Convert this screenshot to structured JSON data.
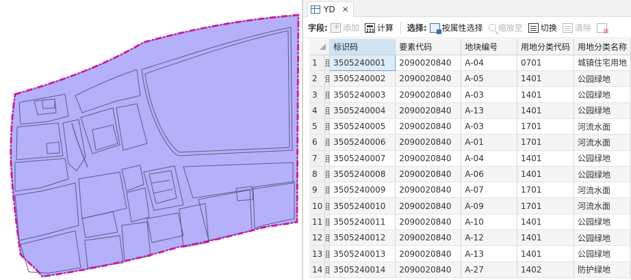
{
  "colors": {
    "parcel_fill": "#b4b0fa",
    "parcel_stroke": "#565e86",
    "boundary": "#d31aa3",
    "selection": "#ddecf8"
  },
  "tab": {
    "icon": "table-icon",
    "title": "YD",
    "close_icon": "close-icon"
  },
  "toolbar": {
    "field_label": "字段:",
    "add_label": "添加",
    "calc_label": "计算",
    "select_label": "选择:",
    "select_by_attr_label": "按属性选择",
    "zoom_label": "缩放至",
    "switch_label": "切换",
    "clear_label": "清除"
  },
  "table": {
    "headers": [
      "标识码",
      "要素代码",
      "地块编号",
      "用地分类代码",
      "用地分类名称"
    ],
    "selected_column": 0,
    "rows": [
      {
        "n": "1",
        "c": [
          "3505240001",
          "2090020840",
          "A-04",
          "0701",
          "城镇住宅用地"
        ]
      },
      {
        "n": "2",
        "c": [
          "3505240002",
          "2090020840",
          "A-05",
          "1401",
          "公园绿地"
        ]
      },
      {
        "n": "3",
        "c": [
          "3505240003",
          "2090020840",
          "A-03",
          "1401",
          "公园绿地"
        ]
      },
      {
        "n": "4",
        "c": [
          "3505240004",
          "2090020840",
          "A-13",
          "1401",
          "公园绿地"
        ]
      },
      {
        "n": "5",
        "c": [
          "3505240005",
          "2090020840",
          "A-03",
          "1701",
          "河流水面"
        ]
      },
      {
        "n": "6",
        "c": [
          "3505240006",
          "2090020840",
          "A-01",
          "1701",
          "河流水面"
        ]
      },
      {
        "n": "7",
        "c": [
          "3505240007",
          "2090020840",
          "A-04",
          "1401",
          "公园绿地"
        ]
      },
      {
        "n": "8",
        "c": [
          "3505240008",
          "2090020840",
          "A-06",
          "1401",
          "公园绿地"
        ]
      },
      {
        "n": "9",
        "c": [
          "3505240009",
          "2090020840",
          "A-07",
          "1701",
          "河流水面"
        ]
      },
      {
        "n": "10",
        "c": [
          "3505240010",
          "2090020840",
          "A-09",
          "1701",
          "河流水面"
        ]
      },
      {
        "n": "11",
        "c": [
          "3505240011",
          "2090020840",
          "A-10",
          "1401",
          "公园绿地"
        ]
      },
      {
        "n": "12",
        "c": [
          "3505240012",
          "2090020840",
          "A-12",
          "1401",
          "公园绿地"
        ]
      },
      {
        "n": "13",
        "c": [
          "3505240013",
          "2090020840",
          "A-13",
          "1401",
          "公园绿地"
        ]
      },
      {
        "n": "14",
        "c": [
          "3505240014",
          "2090020840",
          "A-27",
          "1402",
          "防护绿地"
        ]
      }
    ]
  }
}
